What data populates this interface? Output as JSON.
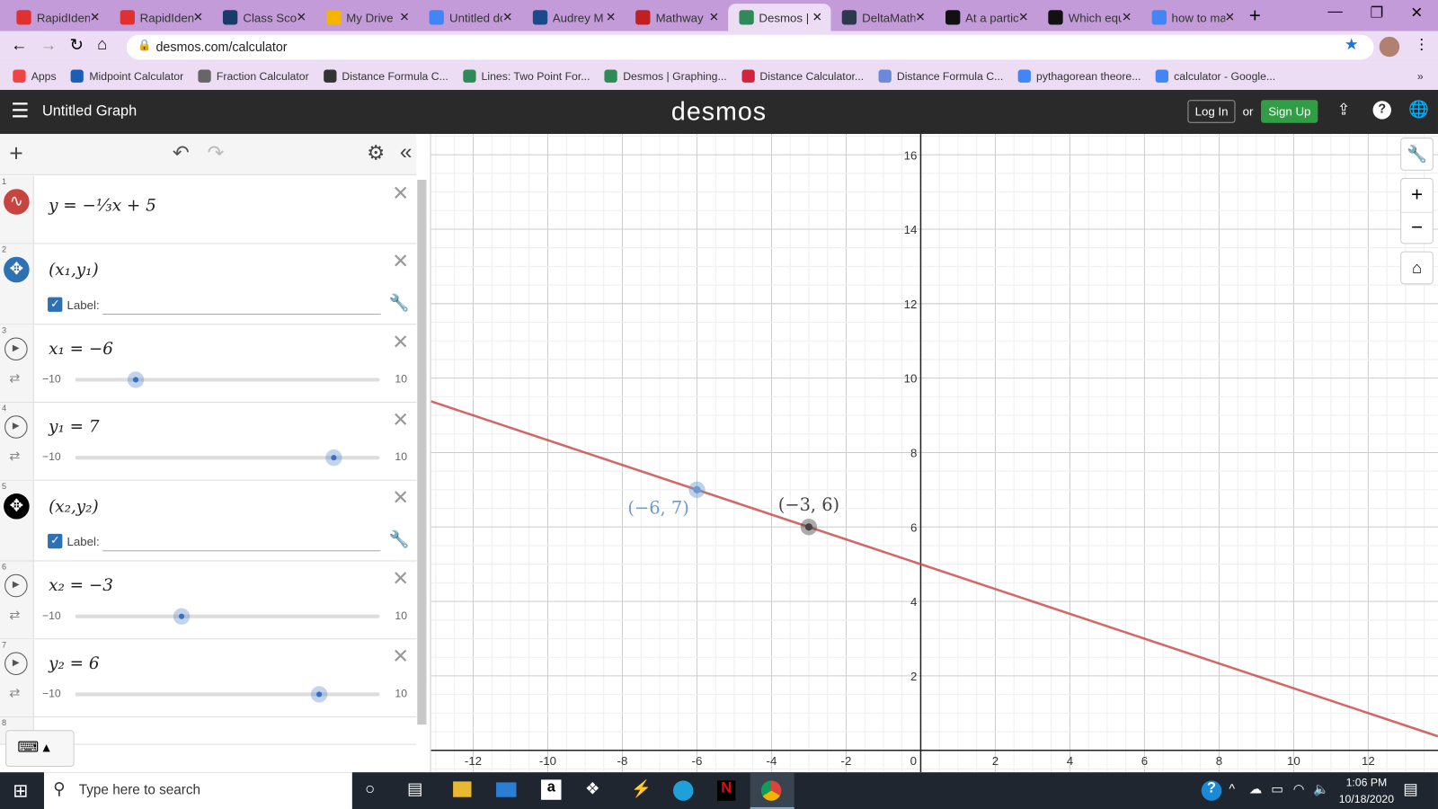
{
  "browser": {
    "tabs": [
      {
        "title": "RapidIdentity",
        "color": "#e03030"
      },
      {
        "title": "RapidIdentity",
        "color": "#e03030"
      },
      {
        "title": "Class Score",
        "color": "#1a3a6a"
      },
      {
        "title": "My Drive",
        "color": "#f4b400"
      },
      {
        "title": "Untitled document",
        "color": "#4285f4"
      },
      {
        "title": "Audrey M",
        "color": "#1a4a8a"
      },
      {
        "title": "Mathway",
        "color": "#c02020"
      },
      {
        "title": "Desmos | Graphing",
        "color": "#2e8b57",
        "active": true
      },
      {
        "title": "DeltaMath",
        "color": "#2a3a4a"
      },
      {
        "title": "At a particular",
        "color": "#111"
      },
      {
        "title": "Which equation",
        "color": "#111"
      },
      {
        "title": "how to make",
        "color": "#4285f4"
      }
    ],
    "url": "desmos.com/calculator",
    "bookmarks": [
      "Apps",
      "Midpoint Calculator",
      "Fraction Calculator",
      "Distance Formula C...",
      "Lines: Two Point For...",
      "Desmos | Graphing...",
      "Distance Calculator...",
      "Distance Formula C...",
      "pythagorean theore...",
      "calculator - Google..."
    ]
  },
  "header": {
    "title": "Untitled Graph",
    "logo": "desmos",
    "login": "Log In",
    "or": "or",
    "signup": "Sign Up"
  },
  "expressions": [
    {
      "num": "1",
      "latex": "y = −⅓x + 5"
    },
    {
      "num": "2",
      "latex": "(x₁,y₁)",
      "label": "Label:"
    },
    {
      "num": "3",
      "latex": "x₁ = −6",
      "min": "−10",
      "max": "10",
      "value": -6
    },
    {
      "num": "4",
      "latex": "y₁ = 7",
      "min": "−10",
      "max": "10",
      "value": 7
    },
    {
      "num": "5",
      "latex": "(x₂,y₂)",
      "label": "Label:"
    },
    {
      "num": "6",
      "latex": "x₂ = −3",
      "min": "−10",
      "max": "10",
      "value": -3
    },
    {
      "num": "7",
      "latex": "y₂ = 6",
      "min": "−10",
      "max": "10",
      "value": 6
    },
    {
      "num": "8"
    }
  ],
  "graph": {
    "line": {
      "slope": -0.3333,
      "intercept": 5,
      "color": "#c74440"
    },
    "points": [
      {
        "x": -6,
        "y": 7,
        "label": "(−6, 7)",
        "color": "#6b9bd2"
      },
      {
        "x": -3,
        "y": 6,
        "label": "(−3, 6)",
        "color": "#444"
      }
    ],
    "xticks": [
      -12,
      -10,
      -8,
      -6,
      -4,
      -2,
      0,
      2,
      4,
      6,
      8,
      10,
      12
    ],
    "yticks": [
      2,
      4,
      6,
      8,
      10,
      12,
      14,
      16
    ],
    "xrange": [
      -13.13,
      13.87
    ],
    "yrange": [
      -0.59,
      16.56
    ]
  },
  "taskbar": {
    "search": "Type here to search",
    "time": "1:06 PM",
    "date": "10/18/2020"
  }
}
